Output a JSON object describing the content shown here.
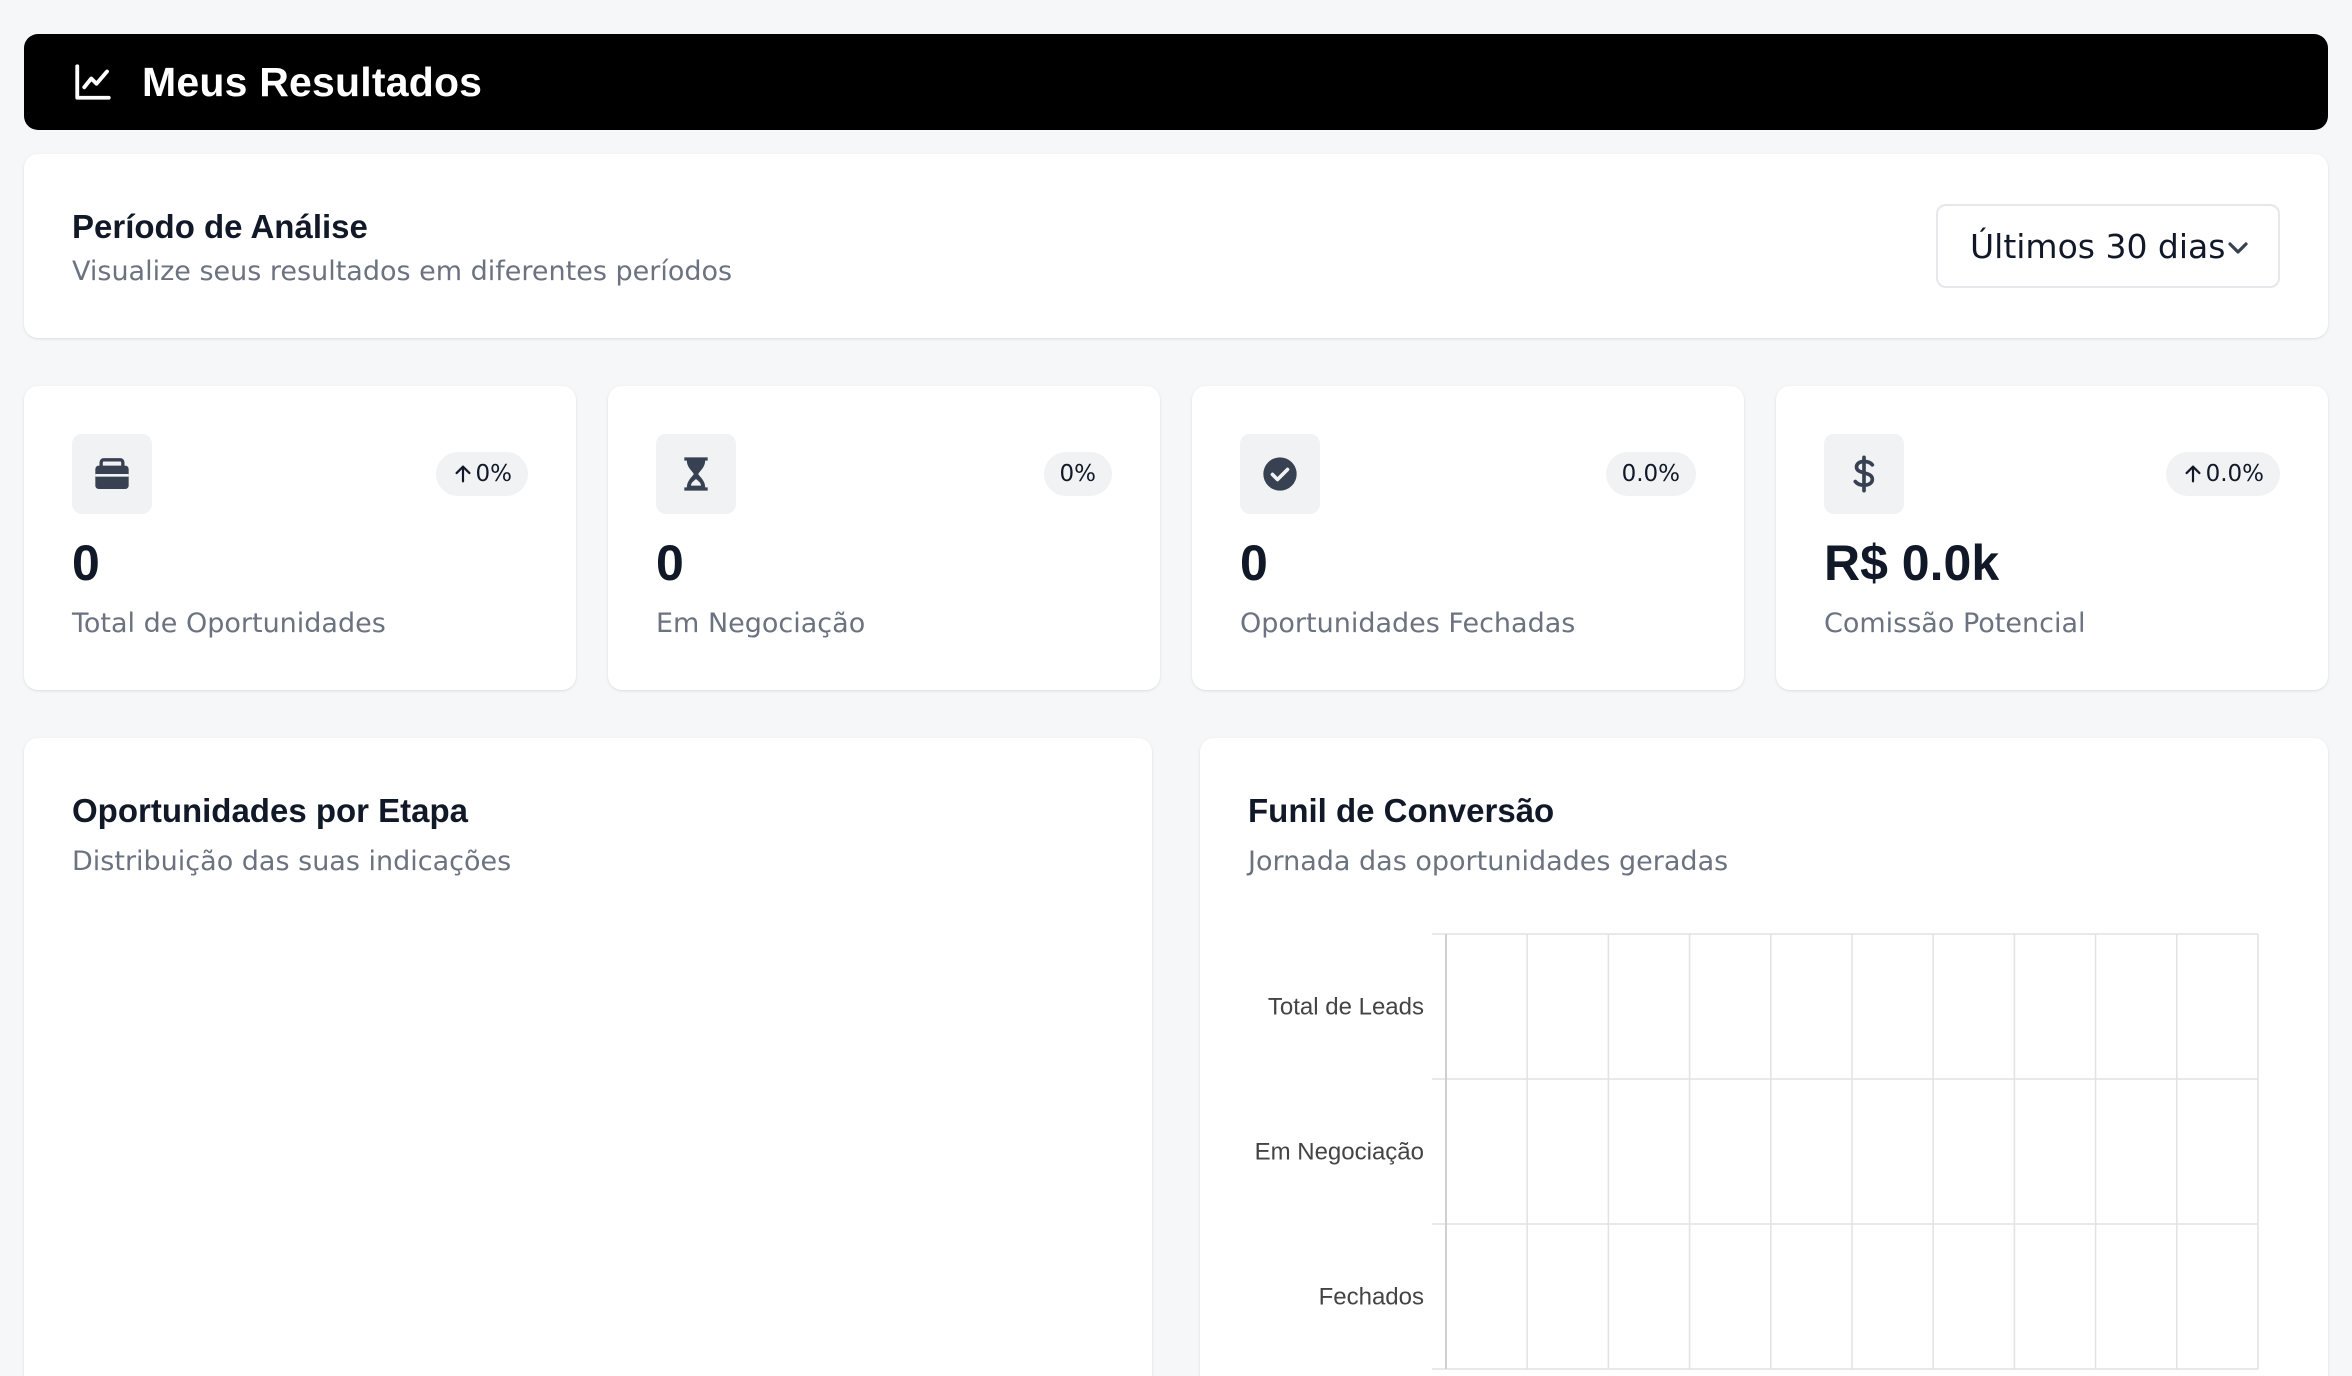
{
  "header": {
    "title": "Meus Resultados",
    "icon": "chart-line-icon"
  },
  "period": {
    "title": "Período de Análise",
    "subtitle": "Visualize seus resultados em diferentes períodos",
    "selected": "Últimos 30 dias"
  },
  "stats": [
    {
      "icon": "briefcase-icon",
      "trend": "0%",
      "trend_up": true,
      "value": "0",
      "label": "Total de Oportunidades"
    },
    {
      "icon": "hourglass-icon",
      "trend": "0%",
      "trend_up": false,
      "value": "0",
      "label": "Em Negociação"
    },
    {
      "icon": "check-circle-icon",
      "trend": "0.0%",
      "trend_up": false,
      "value": "0",
      "label": "Oportunidades Fechadas"
    },
    {
      "icon": "dollar-icon",
      "trend": "0.0%",
      "trend_up": true,
      "value": "R$ 0.0k",
      "label": "Comissão Potencial"
    }
  ],
  "stage_panel": {
    "title": "Oportunidades por Etapa",
    "subtitle": "Distribuição das suas indicações"
  },
  "funnel_panel": {
    "title": "Funil de Conversão",
    "subtitle": "Jornada das oportunidades geradas"
  },
  "chart_data": {
    "type": "bar",
    "orientation": "horizontal",
    "categories": [
      "Total de Leads",
      "Em Negociação",
      "Fechados"
    ],
    "values": [
      0,
      0,
      0
    ],
    "grid": true,
    "vertical_grid_lines": 10
  },
  "colors": {
    "header_bg": "#000000",
    "muted_text": "#6b7280",
    "badge_bg": "#f1f2f4"
  }
}
